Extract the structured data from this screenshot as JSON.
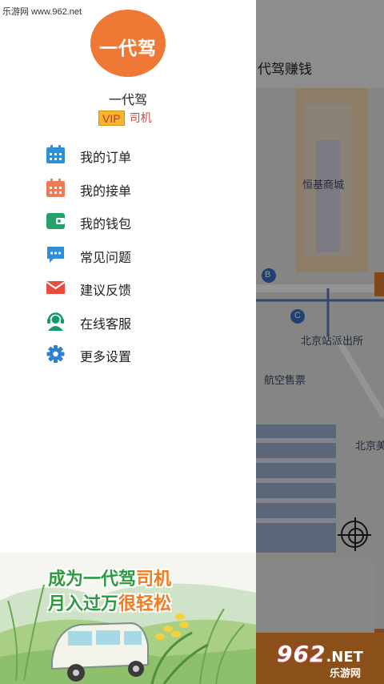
{
  "watermark": {
    "site": "乐游网 www.962.net",
    "bottom_num": "962",
    "bottom_net": ".NET",
    "bottom_cn": "乐游网"
  },
  "map": {
    "header_title": "代驾赚钱",
    "labels": {
      "mall": "恒基商城",
      "police": "北京站派出所",
      "ticket": "航空售票",
      "partial": "北京美"
    },
    "markers": [
      "B",
      "C"
    ]
  },
  "drawer": {
    "logo_text": "一代驾",
    "user_name": "一代驾",
    "vip_badge": "VIP",
    "role": "司机",
    "menu": [
      {
        "label": "我的订单",
        "icon": "calendar-icon",
        "color": "#2e8fd8"
      },
      {
        "label": "我的接单",
        "icon": "calendar-icon",
        "color": "#ee7a5a"
      },
      {
        "label": "我的钱包",
        "icon": "wallet-icon",
        "color": "#26a269"
      },
      {
        "label": "常见问题",
        "icon": "chat-bubble-icon",
        "color": "#2e8fd8"
      },
      {
        "label": "建议反馈",
        "icon": "envelope-icon",
        "color": "#e84c3d"
      },
      {
        "label": "在线客服",
        "icon": "headset-agent-icon",
        "color": "#159a6e"
      },
      {
        "label": "更多设置",
        "icon": "gear-icon",
        "color": "#2e7fd0"
      }
    ],
    "promo": {
      "line1_a": "成为一代驾",
      "line1_b": "司机",
      "line2_a": "月入过万",
      "line2_b": "很轻松"
    }
  },
  "colors": {
    "brand_orange": "#ee7834",
    "vip_gold": "#f5b62f",
    "promo_green": "#2e9a3f"
  }
}
